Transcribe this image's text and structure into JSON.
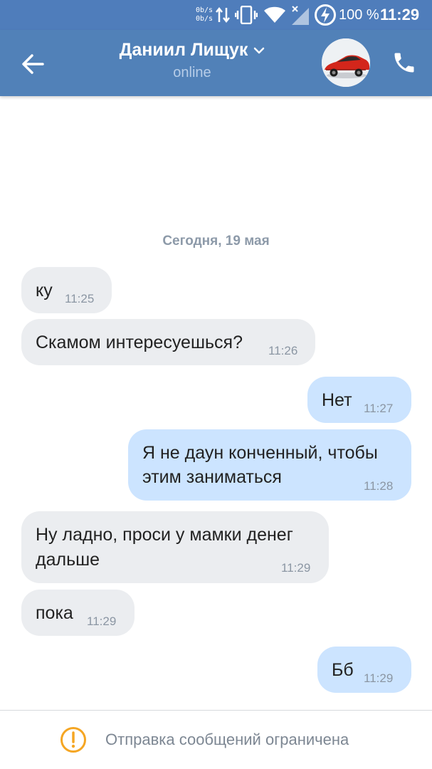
{
  "status_bar": {
    "net_up": "0b/s",
    "net_down": "0b/s",
    "battery": "100 %",
    "time": "11:29",
    "icons": [
      "data-arrows-icon",
      "vibrate-icon",
      "wifi-icon",
      "signal-off-icon",
      "battery-charging-icon"
    ]
  },
  "header": {
    "name": "Даниил Лищук",
    "status": "online",
    "colors": {
      "bar": "#5181b8",
      "text": "#ffffff",
      "status": "#b7cde8"
    }
  },
  "chat": {
    "date": "Сегодня, 19 мая",
    "messages": [
      {
        "dir": "in",
        "lines": [
          "ку"
        ],
        "time": "11:25"
      },
      {
        "dir": "in",
        "lines": [
          "Скамом интересуешься?"
        ],
        "time": "11:26"
      },
      {
        "dir": "out",
        "lines": [
          "Нет"
        ],
        "time": "11:27"
      },
      {
        "dir": "out",
        "lines": [
          "Я не даун конченный, чтобы",
          "этим заниматься"
        ],
        "time": "11:28"
      },
      {
        "dir": "in",
        "lines": [
          "Ну ладно, проси у мамки денег",
          "дальше"
        ],
        "time": "11:29"
      },
      {
        "dir": "in",
        "lines": [
          "пока"
        ],
        "time": "11:29"
      },
      {
        "dir": "out",
        "lines": [
          "Бб"
        ],
        "time": "11:29"
      }
    ],
    "colors": {
      "incoming": "#ebedf0",
      "outgoing": "#cce4ff"
    }
  },
  "footer": {
    "notice": "Отправка сообщений ограничена",
    "icon": "warning-icon",
    "icon_color": "#f5a623"
  }
}
